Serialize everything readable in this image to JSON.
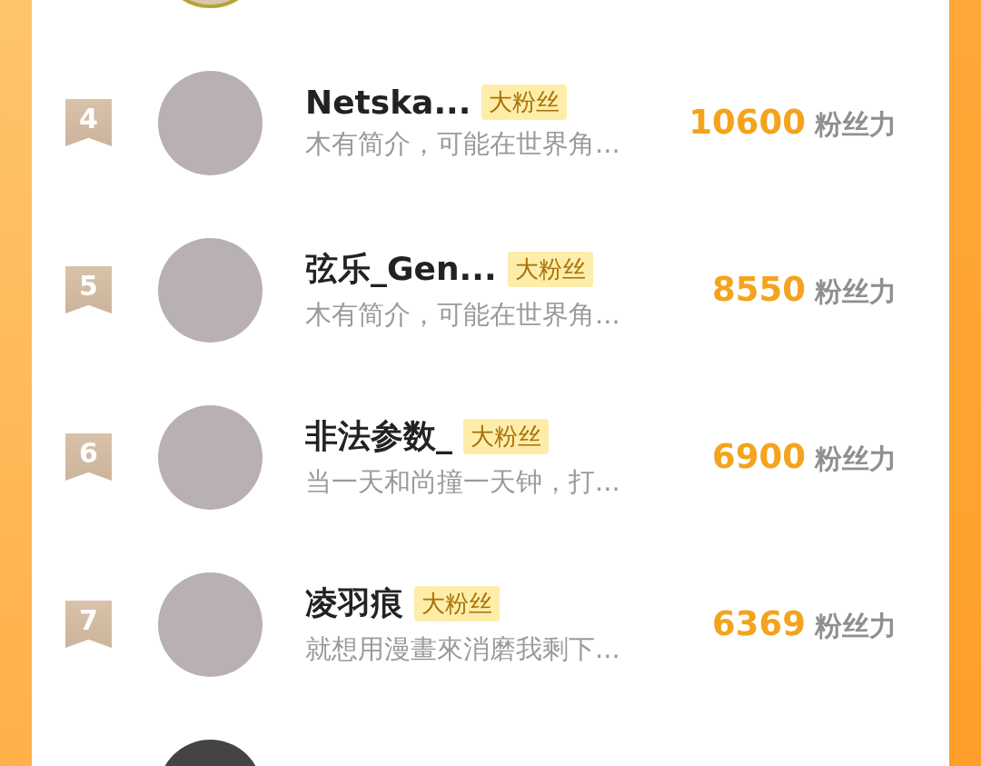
{
  "fans": [
    {
      "rank": "4",
      "name": "Netska...",
      "badge": "大粉丝",
      "bio": "木有简介，可能在世界角...",
      "score": "10600",
      "unit": "粉丝力"
    },
    {
      "rank": "5",
      "name": "弦乐_Gen...",
      "badge": "大粉丝",
      "bio": "木有简介，可能在世界角...",
      "score": "8550",
      "unit": "粉丝力"
    },
    {
      "rank": "6",
      "name": "非法参数_",
      "badge": "大粉丝",
      "bio": "当一天和尚撞一天钟，打...",
      "score": "6900",
      "unit": "粉丝力"
    },
    {
      "rank": "7",
      "name": "凌羽痕",
      "badge": "大粉丝",
      "bio": "就想用漫畫來消磨我剩下...",
      "score": "6369",
      "unit": "粉丝力"
    }
  ]
}
